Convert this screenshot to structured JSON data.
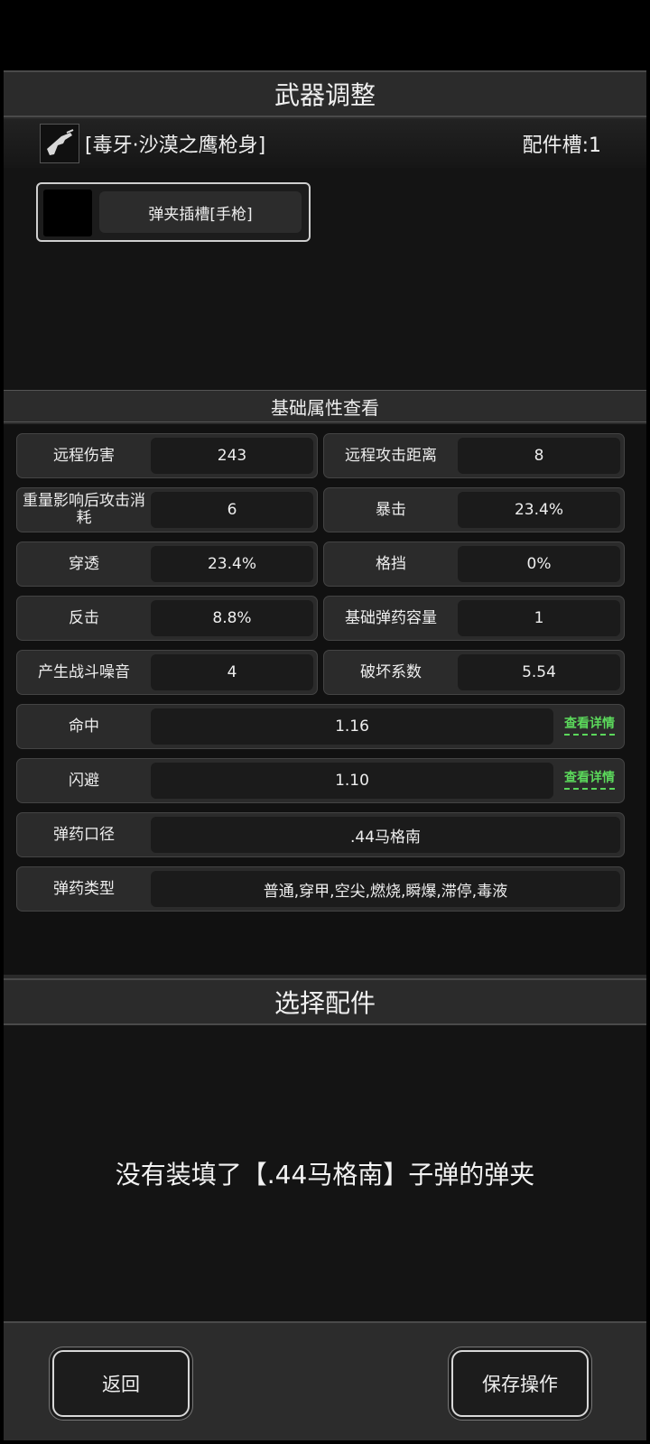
{
  "title": "武器调整",
  "weapon": {
    "icon": "pistol-icon",
    "name": "[毒牙·沙漠之鹰枪身]",
    "slots": "配件槽:1"
  },
  "slot": {
    "label": "弹夹插槽[手枪]"
  },
  "attributes_title": "基础属性查看",
  "attributes": {
    "ranged_damage": {
      "label": "远程伤害",
      "value": "243"
    },
    "ranged_distance": {
      "label": "远程攻击距离",
      "value": "8"
    },
    "weight_cost": {
      "label": "重量影响后攻击消耗",
      "value": "6"
    },
    "crit": {
      "label": "暴击",
      "value": "23.4%"
    },
    "penetrate": {
      "label": "穿透",
      "value": "23.4%"
    },
    "block": {
      "label": "格挡",
      "value": "0%"
    },
    "counter": {
      "label": "反击",
      "value": "8.8%"
    },
    "base_ammo": {
      "label": "基础弹药容量",
      "value": "1"
    },
    "noise": {
      "label": "产生战斗噪音",
      "value": "4"
    },
    "destroy": {
      "label": "破坏系数",
      "value": "5.54"
    },
    "hit": {
      "label": "命中",
      "value": "1.16"
    },
    "dodge": {
      "label": "闪避",
      "value": "1.10"
    },
    "caliber": {
      "label": "弹药口径",
      "value": ".44马格南"
    },
    "ammo_type": {
      "label": "弹药类型",
      "value": "普通,穿甲,空尖,燃烧,瞬爆,滞停,毒液"
    }
  },
  "detail_link": "查看详情",
  "select_title": "选择配件",
  "empty_message": "没有装填了【.44马格南】子弹的弹夹",
  "buttons": {
    "back": "返回",
    "save": "保存操作"
  },
  "colors": {
    "accent_green": "#5bd85b",
    "panel": "#2b2b2b",
    "dark": "#141414"
  }
}
